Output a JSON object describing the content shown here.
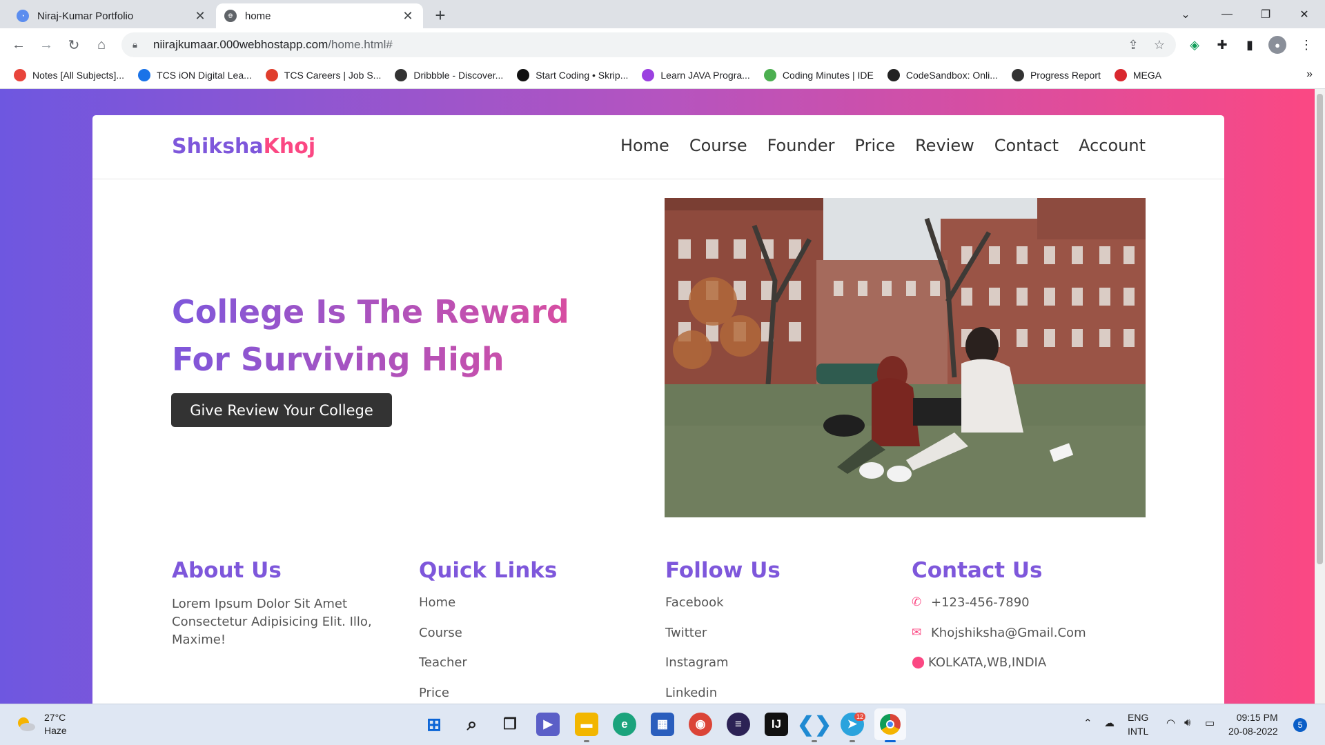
{
  "browser": {
    "tabs": [
      {
        "title": "Niraj-Kumar Portfolio",
        "favicon": "portfolio-favicon"
      },
      {
        "title": "home",
        "favicon": "globe-icon"
      }
    ],
    "url_host": "niirajkumaar.000webhostapp.com",
    "url_path": "/home.html#",
    "bookmarks": [
      {
        "label": "Notes [All Subjects]...",
        "color": "#e8453c"
      },
      {
        "label": "TCS iON Digital Lea...",
        "color": "#1a73e8"
      },
      {
        "label": "TCS Careers | Job S...",
        "color": "#e03e2d"
      },
      {
        "label": "Dribbble - Discover...",
        "color": "#333333"
      },
      {
        "label": "Start Coding • Skrip...",
        "color": "#111111"
      },
      {
        "label": "Learn JAVA Progra...",
        "color": "#9b40e0"
      },
      {
        "label": "Coding Minutes | IDE",
        "color": "#4caf50"
      },
      {
        "label": "CodeSandbox: Onli...",
        "color": "#222222"
      },
      {
        "label": "Progress Report",
        "color": "#333333"
      },
      {
        "label": "MEGA",
        "color": "#d9272e"
      }
    ],
    "bookmarks_more": "»"
  },
  "site": {
    "logo_part1": "Shiksha",
    "logo_part2": "Khoj",
    "nav": [
      "Home",
      "Course",
      "Founder",
      "Price",
      "Review",
      "Contact",
      "Account"
    ],
    "hero_title": "College Is The Reward For Surviving High School",
    "hero_button": "Give Review Your College",
    "footer": {
      "about": {
        "heading": "About Us",
        "text": "Lorem Ipsum Dolor Sit Amet Consectetur Adipisicing Elit. Illo, Maxime!"
      },
      "quick_links": {
        "heading": "Quick Links",
        "links": [
          "Home",
          "Course",
          "Teacher",
          "Price"
        ]
      },
      "follow": {
        "heading": "Follow Us",
        "links": [
          "Facebook",
          "Twitter",
          "Instagram",
          "Linkedin"
        ]
      },
      "contact": {
        "heading": "Contact Us",
        "phone": "+123-456-7890",
        "email": "Khojshiksha@Gmail.Com",
        "address": "KOLKATA,WB,INDIA"
      }
    }
  },
  "taskbar": {
    "weather_temp": "27°C",
    "weather_desc": "Haze",
    "lang_1": "ENG",
    "lang_2": "INTL",
    "time": "09:15 PM",
    "date": "20-08-2022",
    "notifications": "5",
    "telegram_badge": "12"
  },
  "colors": {
    "accent_purple": "#7e57db",
    "accent_pink": "#fb4883",
    "button_dark": "#333333"
  }
}
